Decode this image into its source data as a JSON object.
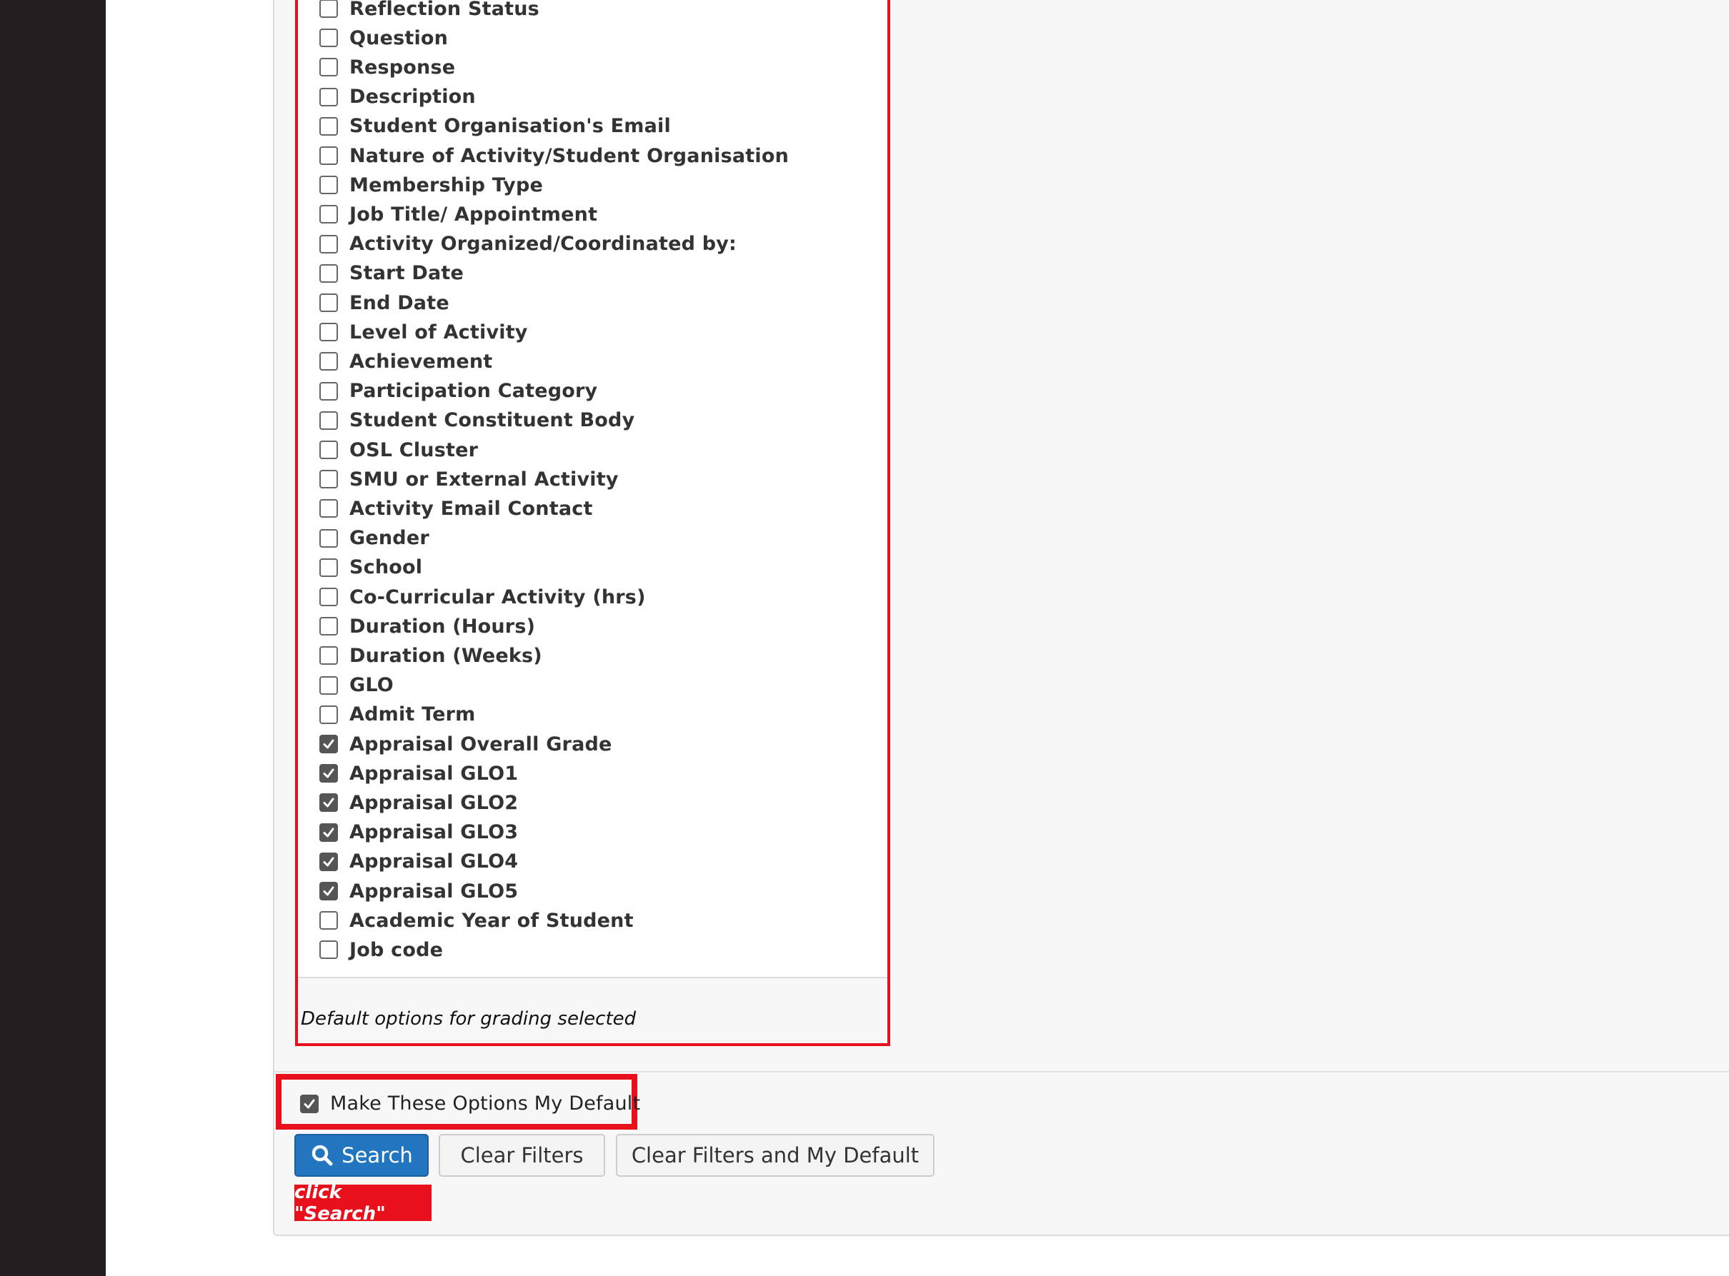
{
  "field_options": [
    {
      "label": "Reflection Status",
      "checked": false
    },
    {
      "label": "Question",
      "checked": false
    },
    {
      "label": "Response",
      "checked": false
    },
    {
      "label": "Description",
      "checked": false
    },
    {
      "label": "Student Organisation's Email",
      "checked": false
    },
    {
      "label": "Nature of Activity/Student Organisation",
      "checked": false
    },
    {
      "label": "Membership Type",
      "checked": false
    },
    {
      "label": "Job Title/ Appointment",
      "checked": false
    },
    {
      "label": "Activity Organized/Coordinated by:",
      "checked": false
    },
    {
      "label": "Start Date",
      "checked": false
    },
    {
      "label": "End Date",
      "checked": false
    },
    {
      "label": "Level of Activity",
      "checked": false
    },
    {
      "label": "Achievement",
      "checked": false
    },
    {
      "label": "Participation Category",
      "checked": false
    },
    {
      "label": "Student Constituent Body",
      "checked": false
    },
    {
      "label": "OSL Cluster",
      "checked": false
    },
    {
      "label": "SMU or External Activity",
      "checked": false
    },
    {
      "label": "Activity Email Contact",
      "checked": false
    },
    {
      "label": "Gender",
      "checked": false
    },
    {
      "label": "School",
      "checked": false
    },
    {
      "label": "Co-Curricular Activity (hrs)",
      "checked": false
    },
    {
      "label": "Duration (Hours)",
      "checked": false
    },
    {
      "label": "Duration (Weeks)",
      "checked": false
    },
    {
      "label": "GLO",
      "checked": false
    },
    {
      "label": "Admit Term",
      "checked": false
    },
    {
      "label": "Appraisal Overall Grade",
      "checked": true
    },
    {
      "label": "Appraisal GLO1",
      "checked": true
    },
    {
      "label": "Appraisal GLO2",
      "checked": true
    },
    {
      "label": "Appraisal GLO3",
      "checked": true
    },
    {
      "label": "Appraisal GLO4",
      "checked": true
    },
    {
      "label": "Appraisal GLO5",
      "checked": true
    },
    {
      "label": "Academic Year of Student",
      "checked": false
    },
    {
      "label": "Job code",
      "checked": false
    }
  ],
  "footer_note": "Default options for grading selected",
  "make_default": {
    "label": "Make These Options My Default",
    "checked": true
  },
  "buttons": {
    "search": "Search",
    "clear_filters": "Clear Filters",
    "clear_filters_default": "Clear Filters and My Default"
  },
  "callout": "click \"Search\"",
  "icons": {
    "search_button": "search-icon",
    "checkbox_checked": "checkmark-icon"
  },
  "colors": {
    "highlight": "#e8101d",
    "primary_button": "#2276bf",
    "sidebar": "#231f20"
  }
}
